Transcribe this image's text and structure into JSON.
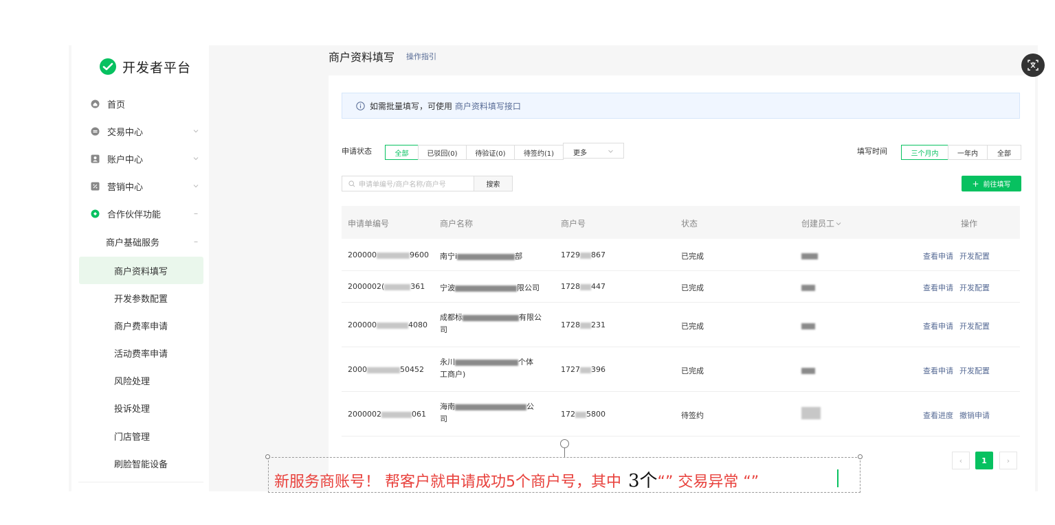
{
  "sidebar": {
    "logo_text": "开发者平台",
    "items": [
      {
        "label": "首页",
        "icon": "home-icon"
      },
      {
        "label": "交易中心",
        "icon": "transaction-icon"
      },
      {
        "label": "账户中心",
        "icon": "account-icon"
      },
      {
        "label": "营销中心",
        "icon": "marketing-icon"
      },
      {
        "label": "合作伙伴功能",
        "icon": "partner-icon"
      }
    ],
    "group": {
      "label": "商户基础服务"
    },
    "sub_items": [
      {
        "label": "商户资料填写"
      },
      {
        "label": "开发参数配置"
      },
      {
        "label": "商户费率申请"
      },
      {
        "label": "活动费率申请"
      },
      {
        "label": "风险处理"
      },
      {
        "label": "投诉处理"
      },
      {
        "label": "门店管理"
      },
      {
        "label": "刷脸智能设备"
      }
    ]
  },
  "header": {
    "title": "商户资料填写",
    "guide_link": "操作指引"
  },
  "notice": {
    "text": "如需批量填写，可使用",
    "link": "商户资料填写接口"
  },
  "filters": {
    "status_label": "申请状态",
    "status_options": [
      "全部",
      "已驳回(0)",
      "待验证(0)",
      "待签约(1)"
    ],
    "more_label": "更多",
    "time_label": "填写时间",
    "time_options": [
      "三个月内",
      "一年内",
      "全部"
    ]
  },
  "search": {
    "placeholder": "申请单编号/商户名称/商户号",
    "button": "搜索",
    "add_button": "前往填写"
  },
  "table": {
    "headers": [
      "申请单编号",
      "商户名称",
      "商户号",
      "状态",
      "创建员工",
      "操作"
    ],
    "rows": [
      {
        "id_start": "200000",
        "id_end": "9600",
        "name_start": "南宁i",
        "name_end": "部",
        "name_cont": "",
        "mch_start": "1729",
        "mch_end": "867",
        "status": "已完成",
        "ops": [
          "查看申请",
          "开发配置"
        ]
      },
      {
        "id_start": "2000002(",
        "id_end": "361",
        "name_start": "宁波",
        "name_end": "限公司",
        "name_cont": "",
        "mch_start": "1728",
        "mch_end": "447",
        "status": "已完成",
        "ops": [
          "查看申请",
          "开发配置"
        ]
      },
      {
        "id_start": "200000",
        "id_end": "4080",
        "name_start": "成都标",
        "name_end": "有限公",
        "name_cont": "司",
        "mch_start": "1728",
        "mch_end": "231",
        "status": "已完成",
        "ops": [
          "查看申请",
          "开发配置"
        ]
      },
      {
        "id_start": "2000",
        "id_end": "50452",
        "name_start": "永川",
        "name_end": "个体",
        "name_cont": "工商户)",
        "mch_start": "1727",
        "mch_end": "396",
        "status": "已完成",
        "ops": [
          "查看申请",
          "开发配置"
        ]
      },
      {
        "id_start": "2000002",
        "id_end": "061",
        "name_start": "海南",
        "name_end": "公",
        "name_cont": "司",
        "mch_start": "172",
        "mch_end": "5800",
        "status": "待签约",
        "ops": [
          "查看进度",
          "撤销申请"
        ]
      }
    ]
  },
  "pagination": {
    "prev": "‹",
    "current": "1",
    "next": "›"
  },
  "annotation": {
    "text_red": "新服务商账号！ 帮客户就申请成功5个商户号，其中",
    "text_black": "3个",
    "text_red2": "“” 交易异常 “”"
  },
  "colors": {
    "accent": "#07c160",
    "link": "#576b95",
    "annotation": "#e8413c"
  }
}
